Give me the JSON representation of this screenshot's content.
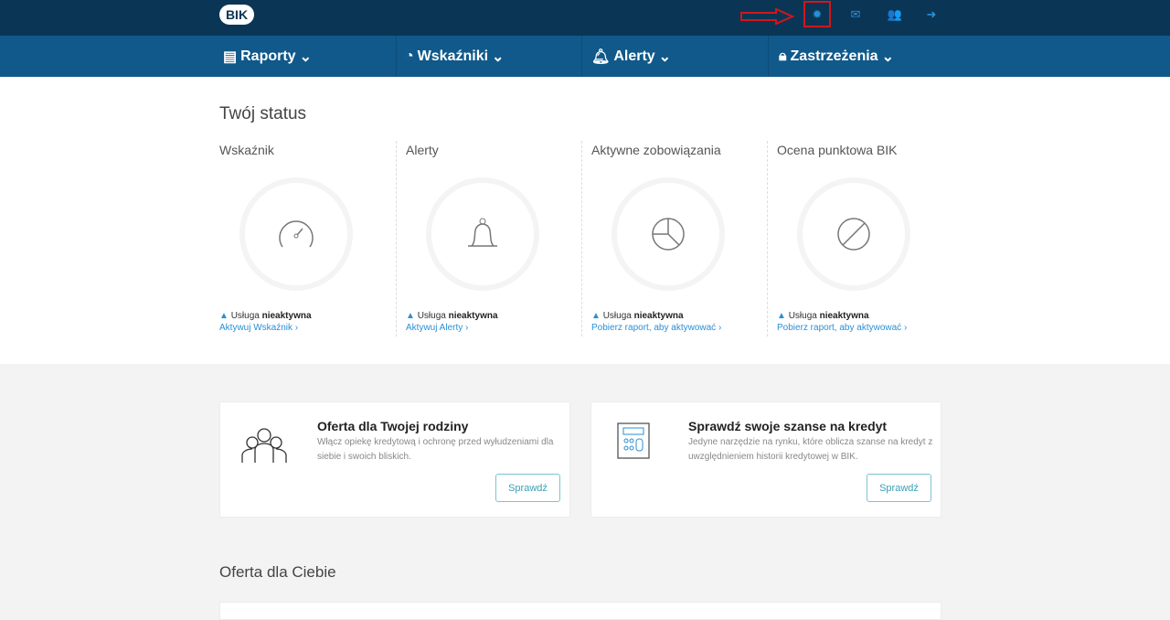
{
  "header": {
    "logo": "BIK",
    "icons": [
      "settings-icon",
      "mail-icon",
      "users-icon",
      "logout-icon"
    ]
  },
  "nav": [
    {
      "label": "Raporty",
      "icon": "document-icon"
    },
    {
      "label": "Wskaźniki",
      "icon": "gauge-icon"
    },
    {
      "label": "Alerty",
      "icon": "bell-icon"
    },
    {
      "label": "Zastrzeżenia",
      "icon": "lock-icon"
    }
  ],
  "status": {
    "title": "Twój status",
    "columns": [
      {
        "title": "Wskaźnik",
        "icon": "gauge-icon",
        "state_prefix": "Usługa",
        "state": "nieaktywna",
        "link": "Aktywuj Wskaźnik ›"
      },
      {
        "title": "Alerty",
        "icon": "bell-icon",
        "state_prefix": "Usługa",
        "state": "nieaktywna",
        "link": "Aktywuj Alerty ›"
      },
      {
        "title": "Aktywne zobowiązania",
        "icon": "pie-icon",
        "state_prefix": "Usługa",
        "state": "nieaktywna",
        "link": "Pobierz raport, aby aktywować ›"
      },
      {
        "title": "Ocena punktowa BIK",
        "icon": "ban-icon",
        "state_prefix": "Usługa",
        "state": "nieaktywna",
        "link": "Pobierz raport, aby aktywować ›"
      }
    ]
  },
  "cards": [
    {
      "title": "Oferta dla Twojej rodziny",
      "desc": "Włącz opiekę kredytową i ochronę przed wyłudzeniami dla siebie i swoich bliskich.",
      "button": "Sprawdź"
    },
    {
      "title": "Sprawdź swoje szanse na kredyt",
      "desc": "Jedyne narzędzie na rynku, które oblicza szanse na kredyt z uwzględnieniem historii kredytowej w BIK.",
      "button": "Sprawdź"
    }
  ],
  "offer": {
    "title": "Oferta dla Ciebie"
  },
  "colors": {
    "topbar": "#0b3555",
    "nav": "#10598a",
    "accent": "#2a8fd6",
    "highlight": "#d0171b"
  }
}
